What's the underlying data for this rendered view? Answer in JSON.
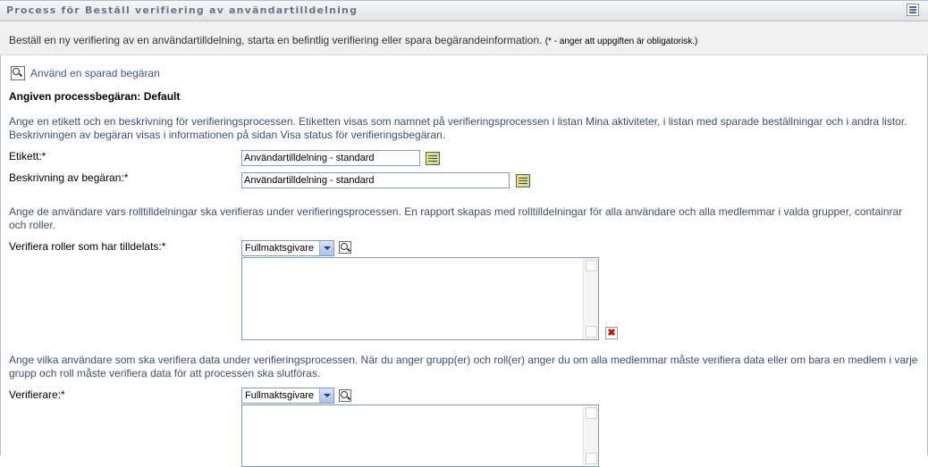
{
  "window": {
    "title": "Process för Beställ verifiering av användartilldelning"
  },
  "intro": {
    "text": "Beställ en ny verifiering av en användartilldelning, starta en befintlig verifiering eller spara begärandeinformation.",
    "note": "(* - anger att uppgiften är obligatorisk.)"
  },
  "saved_request": {
    "label": "Använd en sparad begäran",
    "icon": "magnifier-icon"
  },
  "process_request": {
    "heading": "Angiven processbegäran: Default"
  },
  "section_label": {
    "description": "Ange en etikett och en beskrivning för verifieringsprocessen. Etiketten visas som namnet på verifieringsprocessen i listan Mina aktiviteter, i listan med sparade beställningar och i andra listor. Beskrivningen av begäran visas i informationen på sidan Visa status för verifieringsbegäran.",
    "label_field": {
      "label": "Etikett:*",
      "value": "Användartilldelning - standard",
      "icon": "localize-icon"
    },
    "description_field": {
      "label": "Beskrivning av begäran:*",
      "value": "Användartilldelning - standard",
      "icon": "localize-icon"
    }
  },
  "section_roles": {
    "description": "Ange de användare vars rolltilldelningar ska verifieras under verifieringsprocessen. En rapport skapas med rolltilldelningar för alla användare och alla medlemmar i valda grupper, containrar och roller.",
    "label": "Verifiera roller som har tilldelats:*",
    "select_value": "Fullmaktsgivare",
    "items": []
  },
  "section_verifiers": {
    "description": "Ange vilka användare som ska verifiera data under verifieringsprocessen. När du anger grupp(er) och roll(er) anger du om alla medlemmar måste verifiera data eller om bara en medlem i varje grupp och roll måste verifiera data för att processen ska slutföras.",
    "label": "Verifierare:*",
    "select_value": "Fullmaktsgivare",
    "items": []
  }
}
